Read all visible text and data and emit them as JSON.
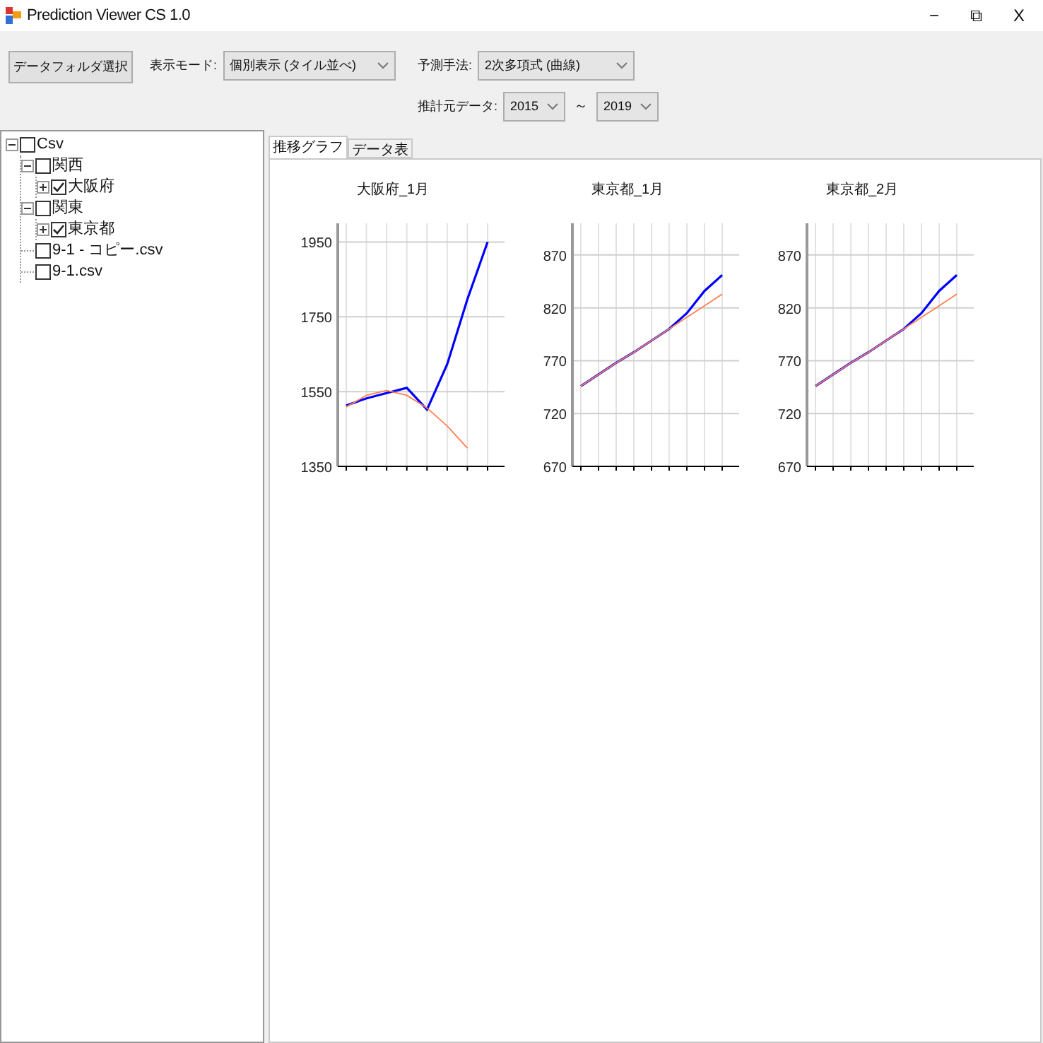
{
  "window": {
    "title": "Prediction Viewer CS 1.0",
    "controls": [
      "−",
      "⧉",
      "X"
    ]
  },
  "toolbar": {
    "folder_button": "データフォルダ選択",
    "display_mode": {
      "label": "表示モード:",
      "value": "個別表示 (タイル並べ)"
    },
    "method": {
      "label": "予測手法:",
      "value": "2次多項式 (曲線)"
    },
    "source": {
      "label": "推計元データ:",
      "from": "2015",
      "separator": "～",
      "to": "2019"
    }
  },
  "tree": [
    {
      "label": "Csv",
      "checked": false,
      "expanded": true,
      "children": [
        {
          "label": "関西",
          "checked": false,
          "expanded": true,
          "children": [
            {
              "label": "大阪府",
              "checked": true,
              "expanded": false
            }
          ]
        },
        {
          "label": "関東",
          "checked": false,
          "expanded": true,
          "children": [
            {
              "label": "東京都",
              "checked": true,
              "expanded": false
            }
          ]
        },
        {
          "label": "9-1 - コピー.csv",
          "checked": false
        },
        {
          "label": "9-1.csv",
          "checked": false
        }
      ]
    }
  ],
  "tabs": [
    {
      "label": "推移グラフ",
      "selected": true
    },
    {
      "label": "データ表",
      "selected": false
    }
  ],
  "charts": [
    {
      "chart_data": {
        "type": "line",
        "title": "大阪府_1月",
        "grid": true,
        "ylim": [
          1350,
          2000
        ],
        "yticks": [
          1350,
          1550,
          1750,
          1950
        ],
        "series": [
          {
            "color": "#0000ff",
            "values": [
              1513,
              1532,
              1546,
              1560,
              1502,
              1623,
              1797,
              1950
            ]
          },
          {
            "color": "#ff7f50",
            "values": [
              1509,
              1540,
              1553,
              1540,
              1506,
              1458,
              1399,
              null
            ]
          }
        ]
      }
    },
    {
      "chart_data": {
        "type": "line",
        "title": "東京都_1月",
        "grid": true,
        "ylim": [
          670,
          900
        ],
        "yticks": [
          670,
          720,
          770,
          820,
          870
        ],
        "series": [
          {
            "color": "#0000ff",
            "values": [
              746,
              757,
              768,
              778,
              789,
              800,
              815,
              836,
              851
            ]
          },
          {
            "color": "#ff7f50",
            "values": [
              746,
              757,
              768,
              778,
              789,
              800,
              811,
              822,
              833
            ]
          }
        ]
      }
    },
    {
      "chart_data": {
        "type": "line",
        "title": "東京都_2月",
        "grid": true,
        "ylim": [
          670,
          900
        ],
        "yticks": [
          670,
          720,
          770,
          820,
          870
        ],
        "series": [
          {
            "color": "#0000ff",
            "values": [
              746,
              757,
              768,
              778,
              789,
              800,
              815,
              836,
              851
            ]
          },
          {
            "color": "#ff7f50",
            "values": [
              746,
              757,
              768,
              778,
              789,
              800,
              811,
              822,
              833
            ]
          }
        ]
      }
    }
  ]
}
